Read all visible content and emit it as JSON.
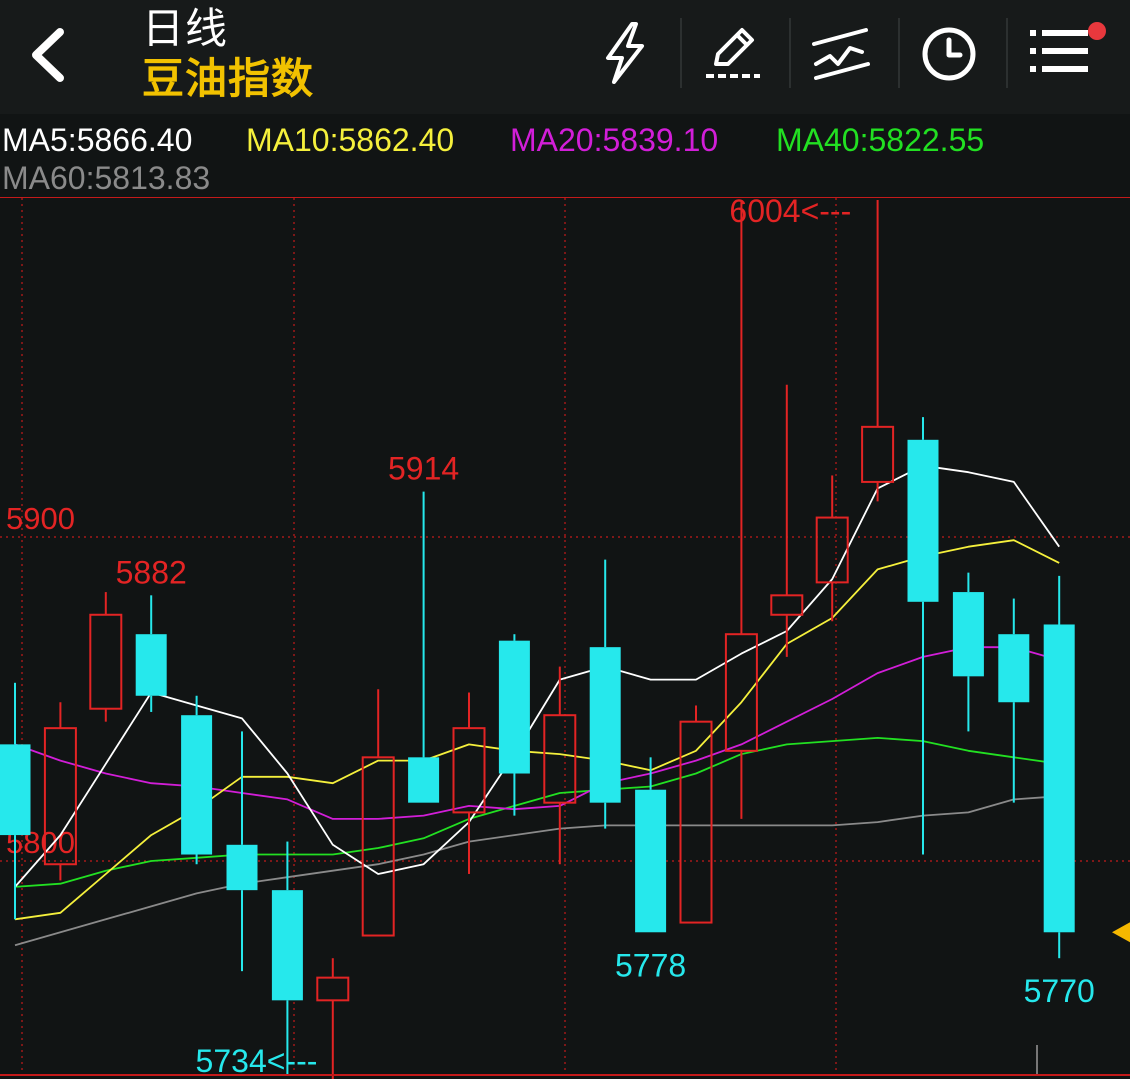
{
  "header": {
    "back_icon": "chevron-left-icon",
    "period": "日线",
    "instrument": "豆油指数",
    "tools": [
      {
        "name": "lightning-icon"
      },
      {
        "name": "draw-pen-icon"
      },
      {
        "name": "trend-line-icon"
      },
      {
        "name": "clock-icon"
      },
      {
        "name": "menu-icon"
      }
    ],
    "notification_color": "#e8383d"
  },
  "ma_legend": [
    {
      "label": "MA5:5866.40",
      "color": "#ffffff"
    },
    {
      "label": "MA10:5862.40",
      "color": "#f5f03c"
    },
    {
      "label": "MA20:5839.10",
      "color": "#d21ed8"
    },
    {
      "label": "MA40:5822.55",
      "color": "#22e022"
    },
    {
      "label": "MA60:5813.83",
      "color": "#8a8a8a"
    }
  ],
  "chart_data": {
    "type": "candlestick",
    "ylim": [
      5728,
      6004
    ],
    "price_lines": [
      {
        "label": "5900",
        "value": 5900
      },
      {
        "label": "5800",
        "value": 5800
      }
    ],
    "candles": [
      {
        "o": 5836,
        "c": 5808,
        "h": 5855,
        "l": 5782
      },
      {
        "o": 5799,
        "c": 5841,
        "h": 5849,
        "l": 5794
      },
      {
        "o": 5847,
        "c": 5876,
        "h": 5883,
        "l": 5843
      },
      {
        "o": 5870,
        "c": 5851,
        "h": 5882,
        "l": 5846
      },
      {
        "o": 5845,
        "c": 5802,
        "h": 5851,
        "l": 5799
      },
      {
        "o": 5805,
        "c": 5791,
        "h": 5840,
        "l": 5766
      },
      {
        "o": 5791,
        "c": 5757,
        "h": 5806,
        "l": 5734
      },
      {
        "o": 5757,
        "c": 5764,
        "h": 5770,
        "l": 5728
      },
      {
        "o": 5777,
        "c": 5832,
        "h": 5853,
        "l": 5777
      },
      {
        "o": 5832,
        "c": 5818,
        "h": 5914,
        "l": 5818
      },
      {
        "o": 5815,
        "c": 5841,
        "h": 5852,
        "l": 5796
      },
      {
        "o": 5868,
        "c": 5827,
        "h": 5870,
        "l": 5814
      },
      {
        "o": 5818,
        "c": 5845,
        "h": 5860,
        "l": 5799
      },
      {
        "o": 5866,
        "c": 5818,
        "h": 5893,
        "l": 5810
      },
      {
        "o": 5822,
        "c": 5778,
        "h": 5832,
        "l": 5778
      },
      {
        "o": 5781,
        "c": 5843,
        "h": 5848,
        "l": 5781
      },
      {
        "o": 5834,
        "c": 5870,
        "h": 6004,
        "l": 5813
      },
      {
        "o": 5876,
        "c": 5882,
        "h": 5947,
        "l": 5863
      },
      {
        "o": 5886,
        "c": 5906,
        "h": 5919,
        "l": 5874
      },
      {
        "o": 5917,
        "c": 5934,
        "h": 6004,
        "l": 5911
      },
      {
        "o": 5930,
        "c": 5880,
        "h": 5937,
        "l": 5802
      },
      {
        "o": 5883,
        "c": 5857,
        "h": 5889,
        "l": 5840
      },
      {
        "o": 5870,
        "c": 5849,
        "h": 5881,
        "l": 5818
      },
      {
        "o": 5873,
        "c": 5778,
        "h": 5888,
        "l": 5770
      }
    ],
    "ma_series": [
      {
        "key": "MA5",
        "values": [
          5792,
          5808,
          5830,
          5852,
          5848,
          5844,
          5827,
          5805,
          5796,
          5799,
          5812,
          5833,
          5856,
          5860,
          5856,
          5856,
          5864,
          5871,
          5887,
          5915,
          5922,
          5920,
          5917,
          5897
        ]
      },
      {
        "key": "MA10",
        "values": [
          5782,
          5784,
          5796,
          5808,
          5816,
          5826,
          5826,
          5824,
          5831,
          5831,
          5836,
          5834,
          5833,
          5831,
          5828,
          5834,
          5849,
          5867,
          5875,
          5890,
          5894,
          5897,
          5899,
          5892
        ]
      },
      {
        "key": "MA20",
        "values": [
          5836,
          5831,
          5827,
          5824,
          5823,
          5821,
          5819,
          5813,
          5813,
          5814,
          5817,
          5816,
          5817,
          5824,
          5827,
          5831,
          5836,
          5843,
          5850,
          5858,
          5863,
          5866,
          5866,
          5862
        ]
      },
      {
        "key": "MA40",
        "values": [
          5792,
          5793,
          5797,
          5800,
          5801,
          5802,
          5802,
          5802,
          5804,
          5807,
          5813,
          5817,
          5821,
          5822,
          5823,
          5827,
          5833,
          5836,
          5837,
          5838,
          5837,
          5834,
          5832,
          5830
        ]
      },
      {
        "key": "MA60",
        "values": [
          5774,
          5778,
          5782,
          5786,
          5790,
          5793,
          5795,
          5797,
          5799,
          5802,
          5806,
          5808,
          5810,
          5811,
          5811,
          5811,
          5811,
          5811,
          5811,
          5812,
          5814,
          5815,
          5819,
          5820
        ]
      }
    ],
    "annotations": [
      {
        "text": "6004<---",
        "value": 6004,
        "candle": 16,
        "color": "#e32424",
        "anchor": "start"
      },
      {
        "text": "5914",
        "value": 5914,
        "candle": 9,
        "color": "#e32424",
        "anchor": "middle"
      },
      {
        "text": "5882",
        "value": 5882,
        "candle": 3,
        "color": "#e32424",
        "anchor": "middle"
      },
      {
        "text": "5778",
        "value": 5778,
        "candle": 14,
        "color": "#26e8ec",
        "anchor": "middle"
      },
      {
        "text": "5770",
        "value": 5770,
        "candle": 23,
        "color": "#26e8ec",
        "anchor": "middle"
      },
      {
        "text": "5734<---",
        "value": 5734,
        "candle": 6,
        "color": "#26e8ec",
        "anchor": "end"
      }
    ],
    "up_color": "#e32424",
    "down_color": "#26e8ec",
    "grid_color": "#c41a1a",
    "price_marker_color": "#f5b800"
  }
}
